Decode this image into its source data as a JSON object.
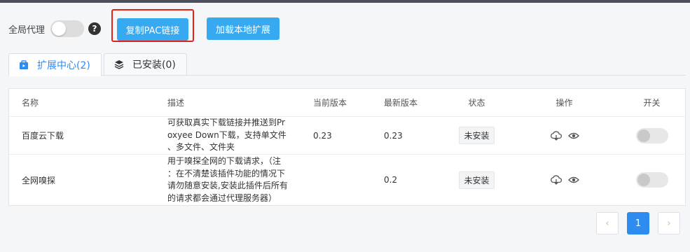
{
  "toolbar": {
    "proxy_label": "全局代理",
    "help_icon": "?",
    "copy_pac_label": "复制PAC链接",
    "load_local_label": "加载本地扩展"
  },
  "tabs": [
    {
      "label": "扩展中心(2)",
      "icon": "store-icon"
    },
    {
      "label": "已安装(0)",
      "icon": "layers-icon"
    }
  ],
  "table": {
    "headers": {
      "name": "名称",
      "desc": "描述",
      "current": "当前版本",
      "latest": "最新版本",
      "status": "状态",
      "ops": "操作",
      "toggle": "开关"
    },
    "rows": [
      {
        "name": "百度云下载",
        "desc_lines": [
          "可获取真实下载链接并推送到Pr",
          "oxyee Down下载，支持单文件",
          "、多文件、文件夹"
        ],
        "current": "0.23",
        "latest": "0.23",
        "status": "未安装"
      },
      {
        "name": "全网嗅探",
        "desc_lines": [
          "用于嗅探全网的下载请求，（注",
          "：在不清楚该插件功能的情况下",
          "请勿随意安装,安装此插件后所有",
          "的请求都会通过代理服务器）"
        ],
        "current": "",
        "latest": "0.2",
        "status": "未安装"
      }
    ]
  },
  "pagination": {
    "prev": "‹",
    "current": "1",
    "next": "›"
  },
  "colors": {
    "accent": "#36a9f0",
    "active_tab": "#2d8cf0",
    "highlight_border": "#e0241c",
    "topbar": "#4a4f5a"
  }
}
